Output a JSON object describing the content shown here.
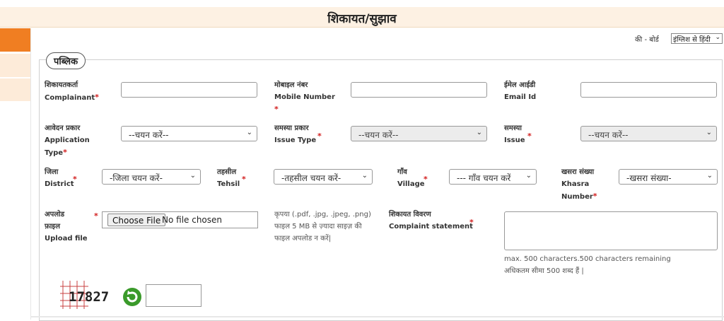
{
  "page": {
    "title": "शिकायत/सुझाव"
  },
  "toolbar": {
    "keyboard_label": "की - बोर्ड",
    "language_select": "इंग्लिश से हिंदी"
  },
  "section": {
    "legend": "पब्लिक"
  },
  "fields": {
    "complainant": {
      "label_hi": "शिकायतकर्ता",
      "label_en": "Complainant",
      "value": ""
    },
    "mobile": {
      "label_hi": "मोबाइल नंबर",
      "label_en": "Mobile Number",
      "value": ""
    },
    "email": {
      "label_hi": "ईमेल आईडी",
      "label_en": "Email Id",
      "value": ""
    },
    "application_type": {
      "label_hi": "आवेदन प्रकार",
      "label_en1": "Application",
      "label_en2": "Type",
      "selected": "--चयन करें--"
    },
    "issue_type": {
      "label_hi": "समस्या प्रकार",
      "label_en": "Issue Type",
      "selected": "--चयन करें--"
    },
    "issue": {
      "label_hi": "समस्या",
      "label_en": "Issue",
      "selected": "--चयन करें--"
    },
    "district": {
      "label_hi": "जिला",
      "label_en": "District",
      "selected": "-जिला चयन करें-"
    },
    "tehsil": {
      "label_hi": "तहसील",
      "label_en": "Tehsil",
      "selected": "-तहसील चयन करें-"
    },
    "village": {
      "label_hi": "गाँव",
      "label_en": "Village",
      "selected": "--- गाँव चयन करें"
    },
    "khasra": {
      "label_hi": "खसरा संख्या",
      "label_en1": "Khasra",
      "label_en2": "Number",
      "selected": "-खसरा संख्या-"
    },
    "upload": {
      "label_hi1": "अपलोड",
      "label_hi2": "फ़ाइल",
      "label_en": "Upload file",
      "button": "Choose File",
      "status": "No file chosen",
      "note1": "कृपया (.pdf, .jpg, .jpeg, .png)",
      "note2": "फाइल 5 MB से ज़्यादा साइज़ की",
      "note3": "फाइल अपलोड न करें|"
    },
    "complaint": {
      "label_hi": "शिकायत विवरण",
      "label_en": "Complaint statement",
      "value": "",
      "limit_en": "max. 500 characters.500 characters remaining",
      "limit_hi": "अधिकतम सीमा 500 शब्द हैं |"
    }
  },
  "captcha": {
    "code": "17827",
    "value": ""
  },
  "required_mark": "*",
  "colors": {
    "accent": "#f07e22",
    "title_bg": "#fdf1e3",
    "required": "#d21d1d",
    "refresh_icon": "#3a9a2a"
  }
}
